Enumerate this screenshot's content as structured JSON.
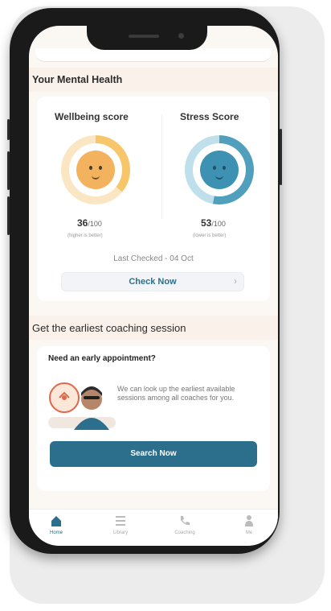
{
  "mental_health": {
    "section_title": "Your Mental Health",
    "wellbeing": {
      "title": "Wellbeing score",
      "value": "36",
      "denominator": "/100",
      "note": "(higher is better)",
      "level": 0.36
    },
    "stress": {
      "title": "Stress Score",
      "value": "53",
      "denominator": "/100",
      "note": "(lower is better)",
      "level": 0.53
    },
    "last_checked": "Last Checked - 04 Oct",
    "check_now_label": "Check Now"
  },
  "coaching": {
    "section_title": "Get the earliest coaching session",
    "question": "Need an early appointment?",
    "description": "We can look up the earliest available sessions among all coaches for you.",
    "search_label": "Search Now"
  },
  "bottom_nav": {
    "items": [
      {
        "label": "Home",
        "icon": "home-icon",
        "active": true
      },
      {
        "label": "Library",
        "icon": "library-icon",
        "active": false
      },
      {
        "label": "Coaching",
        "icon": "phone-icon",
        "active": false
      },
      {
        "label": "Me",
        "icon": "person-icon",
        "active": false
      }
    ]
  },
  "colors": {
    "accent": "#2c6f8d",
    "wellbeing_ring": "#f7c66a",
    "wellbeing_face": "#f3b35e",
    "stress_ring": "#4f9fbd",
    "stress_face": "#3d92b3"
  }
}
